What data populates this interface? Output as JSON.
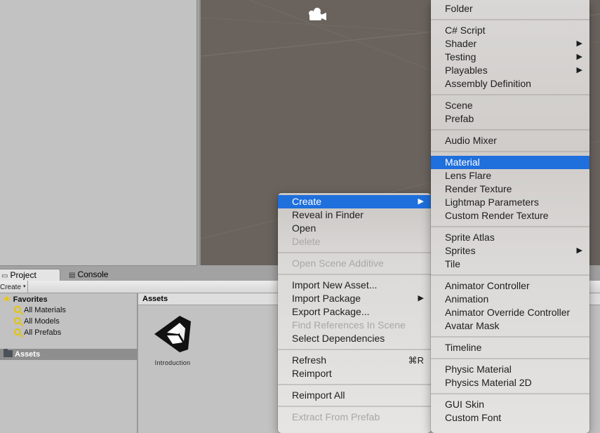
{
  "project_window": {
    "tabs": [
      {
        "label": "Project",
        "icon": "folder-icon",
        "active": true
      },
      {
        "label": "Console",
        "icon": "console-icon",
        "active": false
      }
    ],
    "toolbar": {
      "create_label": "Create",
      "create_caret": "▾"
    },
    "tree": {
      "favorites_label": "Favorites",
      "favorites": [
        {
          "label": "All Materials",
          "icon": "search-icon"
        },
        {
          "label": "All Models",
          "icon": "search-icon"
        },
        {
          "label": "All Prefabs",
          "icon": "search-icon"
        }
      ],
      "assets_label": "Assets"
    },
    "assets_pane": {
      "header": "Assets",
      "items": [
        {
          "label": "Introduction",
          "icon": "unity-logo-icon"
        }
      ]
    }
  },
  "scene_view": {
    "icon": "camera-gizmo-icon"
  },
  "context_menu": {
    "groups": [
      [
        {
          "label": "Create",
          "submenu": true,
          "highlight": true
        },
        {
          "label": "Reveal in Finder"
        },
        {
          "label": "Open"
        },
        {
          "label": "Delete",
          "disabled": true
        }
      ],
      [
        {
          "label": "Open Scene Additive",
          "disabled": true
        }
      ],
      [
        {
          "label": "Import New Asset..."
        },
        {
          "label": "Import Package",
          "submenu": true
        },
        {
          "label": "Export Package..."
        },
        {
          "label": "Find References In Scene",
          "disabled": true
        },
        {
          "label": "Select Dependencies"
        }
      ],
      [
        {
          "label": "Refresh",
          "shortcut": "⌘R"
        },
        {
          "label": "Reimport"
        }
      ],
      [
        {
          "label": "Reimport All"
        }
      ],
      [
        {
          "label": "Extract From Prefab",
          "disabled": true
        }
      ]
    ]
  },
  "create_submenu": {
    "groups": [
      [
        {
          "label": "Folder"
        }
      ],
      [
        {
          "label": "C# Script"
        },
        {
          "label": "Shader",
          "submenu": true
        },
        {
          "label": "Testing",
          "submenu": true
        },
        {
          "label": "Playables",
          "submenu": true
        },
        {
          "label": "Assembly Definition"
        }
      ],
      [
        {
          "label": "Scene"
        },
        {
          "label": "Prefab"
        }
      ],
      [
        {
          "label": "Audio Mixer"
        }
      ],
      [
        {
          "label": "Material",
          "highlight": true
        },
        {
          "label": "Lens Flare"
        },
        {
          "label": "Render Texture"
        },
        {
          "label": "Lightmap Parameters"
        },
        {
          "label": "Custom Render Texture"
        }
      ],
      [
        {
          "label": "Sprite Atlas"
        },
        {
          "label": "Sprites",
          "submenu": true
        },
        {
          "label": "Tile"
        }
      ],
      [
        {
          "label": "Animator Controller"
        },
        {
          "label": "Animation"
        },
        {
          "label": "Animator Override Controller"
        },
        {
          "label": "Avatar Mask"
        }
      ],
      [
        {
          "label": "Timeline"
        }
      ],
      [
        {
          "label": "Physic Material"
        },
        {
          "label": "Physics Material 2D"
        }
      ],
      [
        {
          "label": "GUI Skin"
        },
        {
          "label": "Custom Font"
        }
      ]
    ]
  },
  "colors": {
    "highlight": "#1f6fdc",
    "scene_bg": "#6a635d",
    "panel_bg": "#c2c2c2",
    "selected_row": "#8e8e8e"
  }
}
